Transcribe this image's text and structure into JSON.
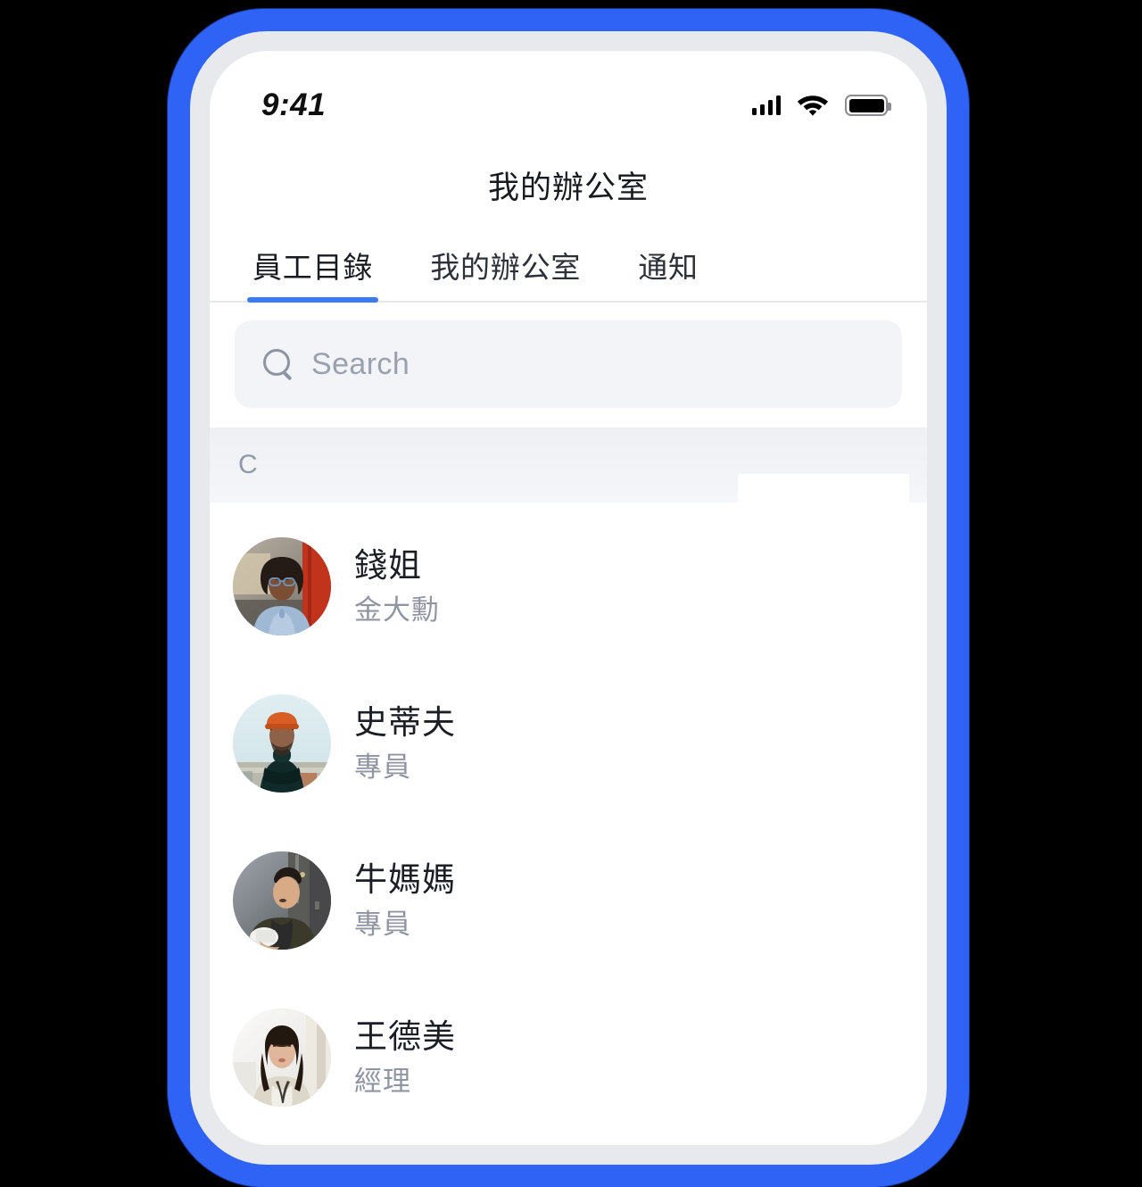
{
  "theme": {
    "frame_blue": "#2f63f5",
    "accent_blue": "#3b7bf7",
    "bezel_gray": "#e7e9ed",
    "search_bg": "#f2f4f8",
    "section_bg": "#eef0f4",
    "title_color": "#1b1e25",
    "subtitle_color": "#8f95a3",
    "placeholder_color": "#9aa0ad"
  },
  "status_bar": {
    "time": "9:41",
    "signal_icon": "cellular-signal-icon",
    "wifi_icon": "wifi-icon",
    "battery_icon": "battery-full-icon"
  },
  "nav": {
    "title": "我的辦公室"
  },
  "tabs": [
    {
      "label": "員工目錄",
      "active": true
    },
    {
      "label": "我的辦公室",
      "active": false
    },
    {
      "label": "通知",
      "active": false
    }
  ],
  "search": {
    "icon": "search-icon",
    "placeholder": "Search",
    "value": ""
  },
  "section": {
    "header_label": "C"
  },
  "employees": [
    {
      "name": "錢姐",
      "role": "金大勳",
      "avatar": "woman-glasses-denim-shirt-city-photo"
    },
    {
      "name": "史蒂夫",
      "role": "專員",
      "avatar": "man-orange-beanie-turtleneck-rooftop-photo"
    },
    {
      "name": "牛媽媽",
      "role": "專員",
      "avatar": "man-olive-blazer-holding-cup-photo"
    },
    {
      "name": "王德美",
      "role": "經理",
      "avatar": "woman-long-hair-beige-cardigan-photo"
    }
  ]
}
